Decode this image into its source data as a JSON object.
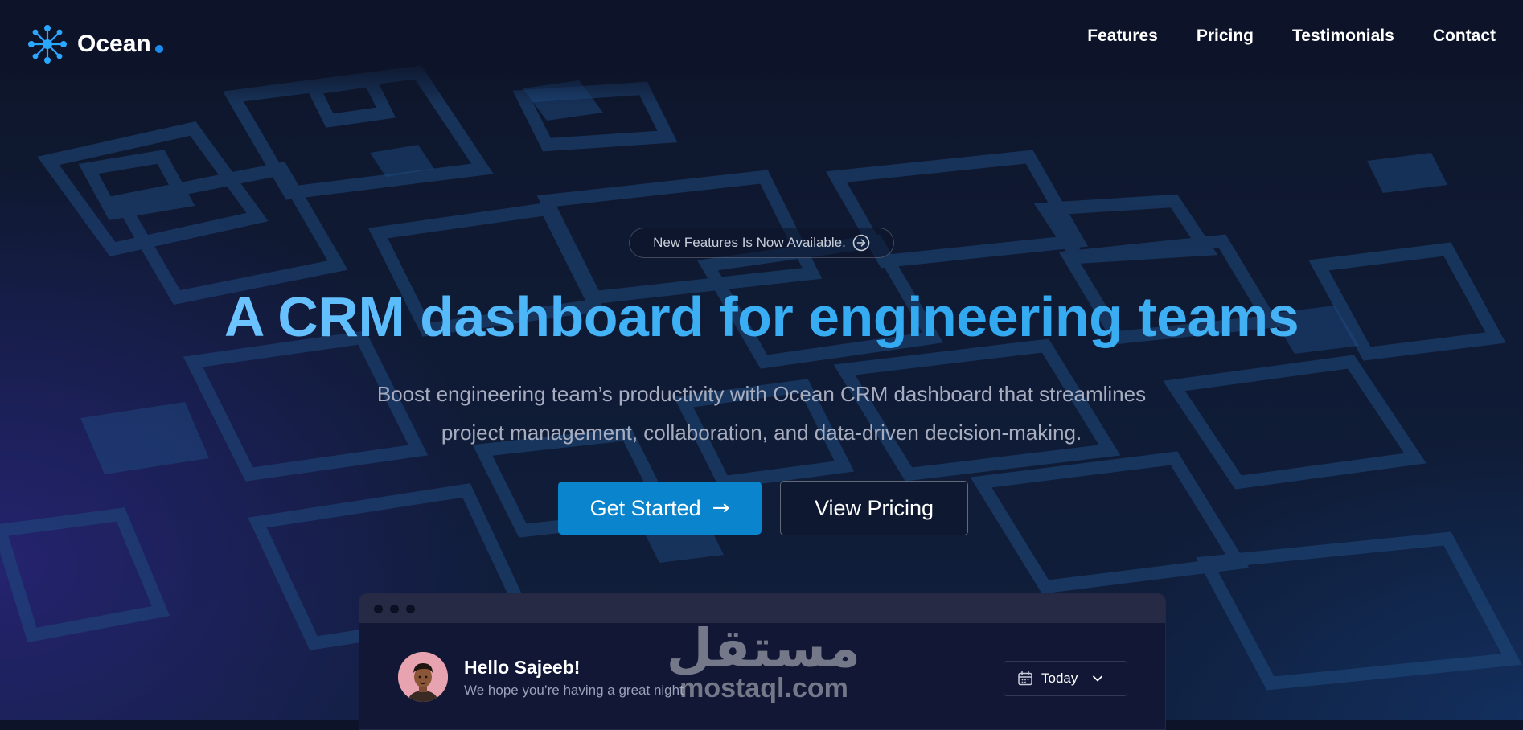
{
  "brand": {
    "name": "Ocean",
    "logo_icon": "molecule-network-icon",
    "accent_color": "#1a8cf0"
  },
  "nav": {
    "items": [
      "Features",
      "Pricing",
      "Testimonials",
      "Contact"
    ]
  },
  "hero": {
    "announcement": "New Features Is Now Available.",
    "announcement_icon": "circle-arrow-right-icon",
    "title": "A CRM dashboard for engineering teams",
    "subtitle_line1": "Boost engineering team’s productivity with Ocean CRM dashboard that streamlines",
    "subtitle_line2": "project management, collaboration, and data-driven decision-making.",
    "primary_button": "Get Started",
    "primary_button_arrow": "→",
    "secondary_button": "View Pricing",
    "primary_color": "#0a84cc",
    "title_gradient": [
      "#6ec4ff",
      "#30a8f0"
    ]
  },
  "dashboard_preview": {
    "greeting": "Hello Sajeeb!",
    "greeting_sub": "We hope you’re having a great night",
    "date_filter": "Today",
    "date_icon": "calendar-icon",
    "dropdown_icon": "chevron-down-icon"
  },
  "watermark": {
    "arabic": "مستقل",
    "latin": "mostaql.com"
  }
}
